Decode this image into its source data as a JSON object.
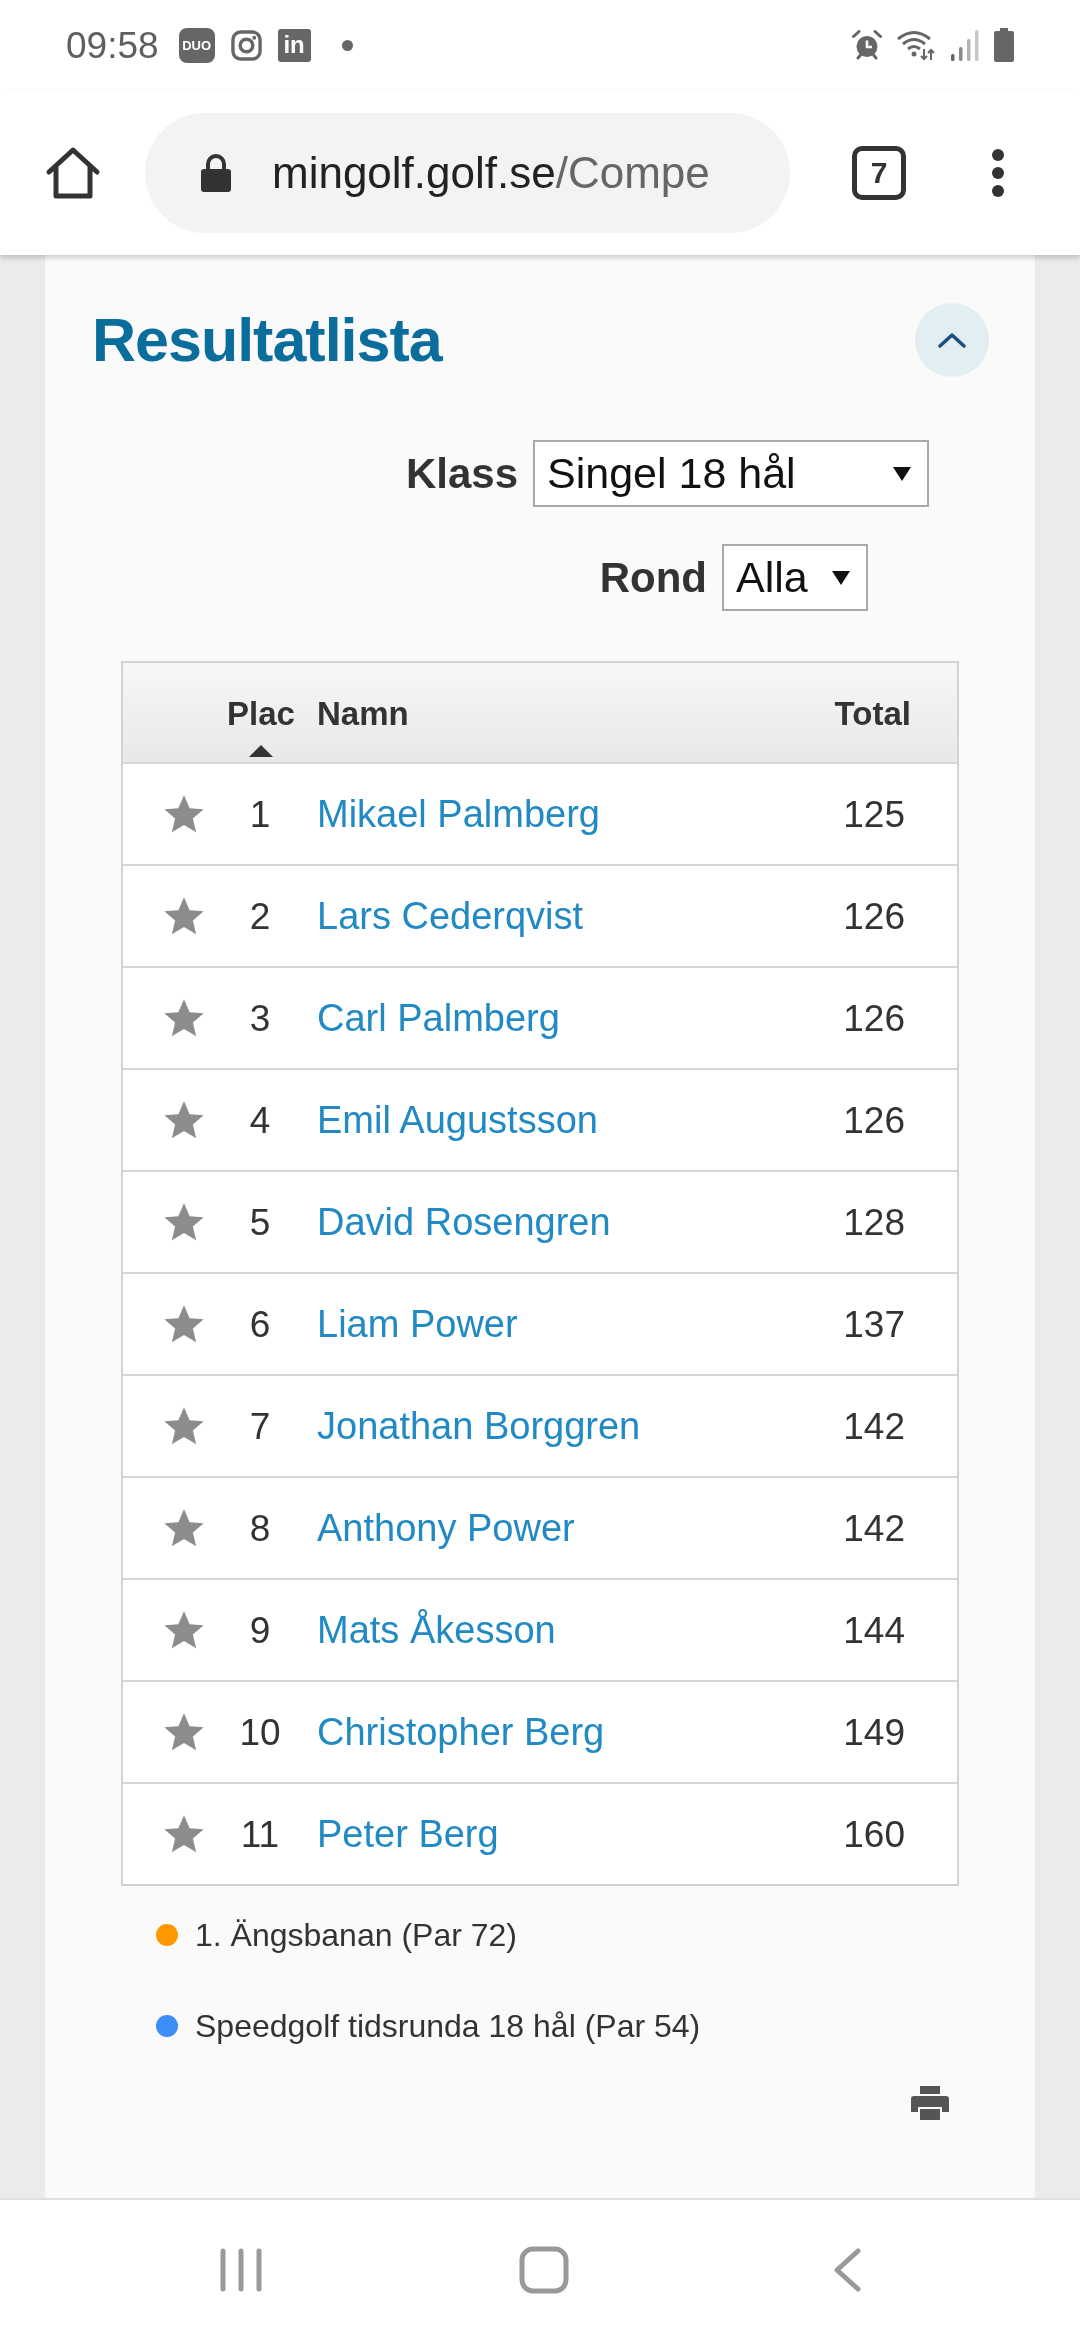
{
  "status_bar": {
    "time": "09:58",
    "notifications": [
      {
        "kind": "badge",
        "label": "DUO"
      },
      {
        "kind": "camera"
      },
      {
        "kind": "tile",
        "label": "in"
      },
      {
        "kind": "dot"
      }
    ]
  },
  "browser": {
    "url_host": "mingolf.golf.se",
    "url_path": "/Compe",
    "tab_count": "7"
  },
  "panel": {
    "title": "Resultatlista",
    "expanded": true
  },
  "filters": [
    {
      "label": "Klass",
      "value": "Singel 18 hål"
    },
    {
      "label": "Rond",
      "value": "Alla"
    }
  ],
  "table": {
    "columns": [
      {
        "label": "Plac",
        "sorted": true
      },
      {
        "label": "Namn",
        "sorted": false
      },
      {
        "label": "Total",
        "sorted": false
      }
    ],
    "rows": [
      {
        "starred": false,
        "place": "1",
        "name": "Mikael Palmberg",
        "total": "125"
      },
      {
        "starred": false,
        "place": "2",
        "name": "Lars Cederqvist",
        "total": "126"
      },
      {
        "starred": false,
        "place": "3",
        "name": "Carl Palmberg",
        "total": "126"
      },
      {
        "starred": false,
        "place": "4",
        "name": "Emil Augustsson",
        "total": "126"
      },
      {
        "starred": false,
        "place": "5",
        "name": "David Rosengren",
        "total": "128"
      },
      {
        "starred": false,
        "place": "6",
        "name": "Liam Power",
        "total": "137"
      },
      {
        "starred": false,
        "place": "7",
        "name": "Jonathan Borggren",
        "total": "142"
      },
      {
        "starred": false,
        "place": "8",
        "name": "Anthony Power",
        "total": "142"
      },
      {
        "starred": false,
        "place": "9",
        "name": "Mats Åkesson",
        "total": "144"
      },
      {
        "starred": false,
        "place": "10",
        "name": "Christopher Berg",
        "total": "149"
      },
      {
        "starred": false,
        "place": "11",
        "name": "Peter Berg",
        "total": "160"
      }
    ]
  },
  "legend": [
    {
      "text": "1. Ängsbanan (Par 72)",
      "color": "#ff9800"
    },
    {
      "text": "Speedgolf tidsrunda 18 hål (Par 54)",
      "color": "#3d8ef5"
    }
  ]
}
